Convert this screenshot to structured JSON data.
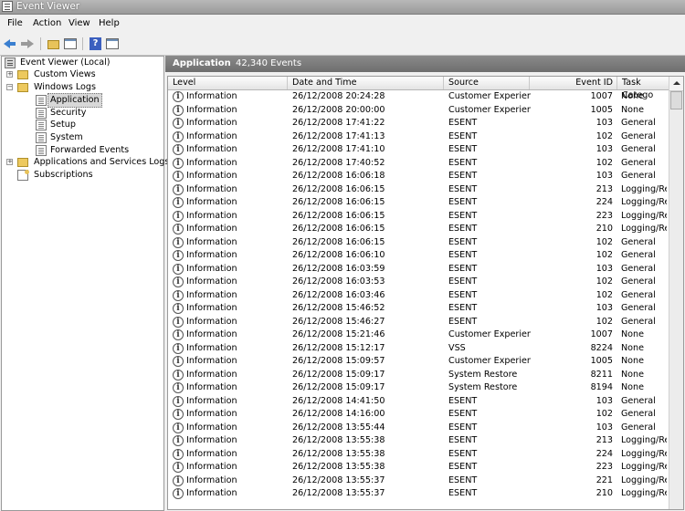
{
  "window": {
    "title": "Event Viewer"
  },
  "menu": {
    "items": [
      "File",
      "Action",
      "View",
      "Help"
    ]
  },
  "tree": {
    "root": "Event Viewer (Local)",
    "custom_views": "Custom Views",
    "windows_logs": "Windows Logs",
    "application": "Application",
    "security": "Security",
    "setup": "Setup",
    "system": "System",
    "forwarded": "Forwarded Events",
    "apps_services": "Applications and Services Logs",
    "subscriptions": "Subscriptions",
    "expand_collapsed": "+",
    "expand_open": "−"
  },
  "pane": {
    "title": "Application",
    "count": "42,340 Events"
  },
  "columns": {
    "level": "Level",
    "date": "Date and Time",
    "source": "Source",
    "event_id": "Event ID",
    "task": "Task Catego"
  },
  "info_glyph": "i",
  "events": [
    {
      "level": "Information",
      "date": "26/12/2008 20:24:28",
      "source": "Customer Experien...",
      "id": "1007",
      "task": "None"
    },
    {
      "level": "Information",
      "date": "26/12/2008 20:00:00",
      "source": "Customer Experien...",
      "id": "1005",
      "task": "None"
    },
    {
      "level": "Information",
      "date": "26/12/2008 17:41:22",
      "source": "ESENT",
      "id": "103",
      "task": "General"
    },
    {
      "level": "Information",
      "date": "26/12/2008 17:41:13",
      "source": "ESENT",
      "id": "102",
      "task": "General"
    },
    {
      "level": "Information",
      "date": "26/12/2008 17:41:10",
      "source": "ESENT",
      "id": "103",
      "task": "General"
    },
    {
      "level": "Information",
      "date": "26/12/2008 17:40:52",
      "source": "ESENT",
      "id": "102",
      "task": "General"
    },
    {
      "level": "Information",
      "date": "26/12/2008 16:06:18",
      "source": "ESENT",
      "id": "103",
      "task": "General"
    },
    {
      "level": "Information",
      "date": "26/12/2008 16:06:15",
      "source": "ESENT",
      "id": "213",
      "task": "Logging/Re"
    },
    {
      "level": "Information",
      "date": "26/12/2008 16:06:15",
      "source": "ESENT",
      "id": "224",
      "task": "Logging/Re"
    },
    {
      "level": "Information",
      "date": "26/12/2008 16:06:15",
      "source": "ESENT",
      "id": "223",
      "task": "Logging/Re"
    },
    {
      "level": "Information",
      "date": "26/12/2008 16:06:15",
      "source": "ESENT",
      "id": "210",
      "task": "Logging/Re"
    },
    {
      "level": "Information",
      "date": "26/12/2008 16:06:15",
      "source": "ESENT",
      "id": "102",
      "task": "General"
    },
    {
      "level": "Information",
      "date": "26/12/2008 16:06:10",
      "source": "ESENT",
      "id": "102",
      "task": "General"
    },
    {
      "level": "Information",
      "date": "26/12/2008 16:03:59",
      "source": "ESENT",
      "id": "103",
      "task": "General"
    },
    {
      "level": "Information",
      "date": "26/12/2008 16:03:53",
      "source": "ESENT",
      "id": "102",
      "task": "General"
    },
    {
      "level": "Information",
      "date": "26/12/2008 16:03:46",
      "source": "ESENT",
      "id": "102",
      "task": "General"
    },
    {
      "level": "Information",
      "date": "26/12/2008 15:46:52",
      "source": "ESENT",
      "id": "103",
      "task": "General"
    },
    {
      "level": "Information",
      "date": "26/12/2008 15:46:27",
      "source": "ESENT",
      "id": "102",
      "task": "General"
    },
    {
      "level": "Information",
      "date": "26/12/2008 15:21:46",
      "source": "Customer Experien...",
      "id": "1007",
      "task": "None"
    },
    {
      "level": "Information",
      "date": "26/12/2008 15:12:17",
      "source": "VSS",
      "id": "8224",
      "task": "None"
    },
    {
      "level": "Information",
      "date": "26/12/2008 15:09:57",
      "source": "Customer Experien...",
      "id": "1005",
      "task": "None"
    },
    {
      "level": "Information",
      "date": "26/12/2008 15:09:17",
      "source": "System Restore",
      "id": "8211",
      "task": "None"
    },
    {
      "level": "Information",
      "date": "26/12/2008 15:09:17",
      "source": "System Restore",
      "id": "8194",
      "task": "None"
    },
    {
      "level": "Information",
      "date": "26/12/2008 14:41:50",
      "source": "ESENT",
      "id": "103",
      "task": "General"
    },
    {
      "level": "Information",
      "date": "26/12/2008 14:16:00",
      "source": "ESENT",
      "id": "102",
      "task": "General"
    },
    {
      "level": "Information",
      "date": "26/12/2008 13:55:44",
      "source": "ESENT",
      "id": "103",
      "task": "General"
    },
    {
      "level": "Information",
      "date": "26/12/2008 13:55:38",
      "source": "ESENT",
      "id": "213",
      "task": "Logging/Re"
    },
    {
      "level": "Information",
      "date": "26/12/2008 13:55:38",
      "source": "ESENT",
      "id": "224",
      "task": "Logging/Re"
    },
    {
      "level": "Information",
      "date": "26/12/2008 13:55:38",
      "source": "ESENT",
      "id": "223",
      "task": "Logging/Re"
    },
    {
      "level": "Information",
      "date": "26/12/2008 13:55:37",
      "source": "ESENT",
      "id": "221",
      "task": "Logging/Re"
    },
    {
      "level": "Information",
      "date": "26/12/2008 13:55:37",
      "source": "ESENT",
      "id": "210",
      "task": "Logging/Re"
    }
  ]
}
